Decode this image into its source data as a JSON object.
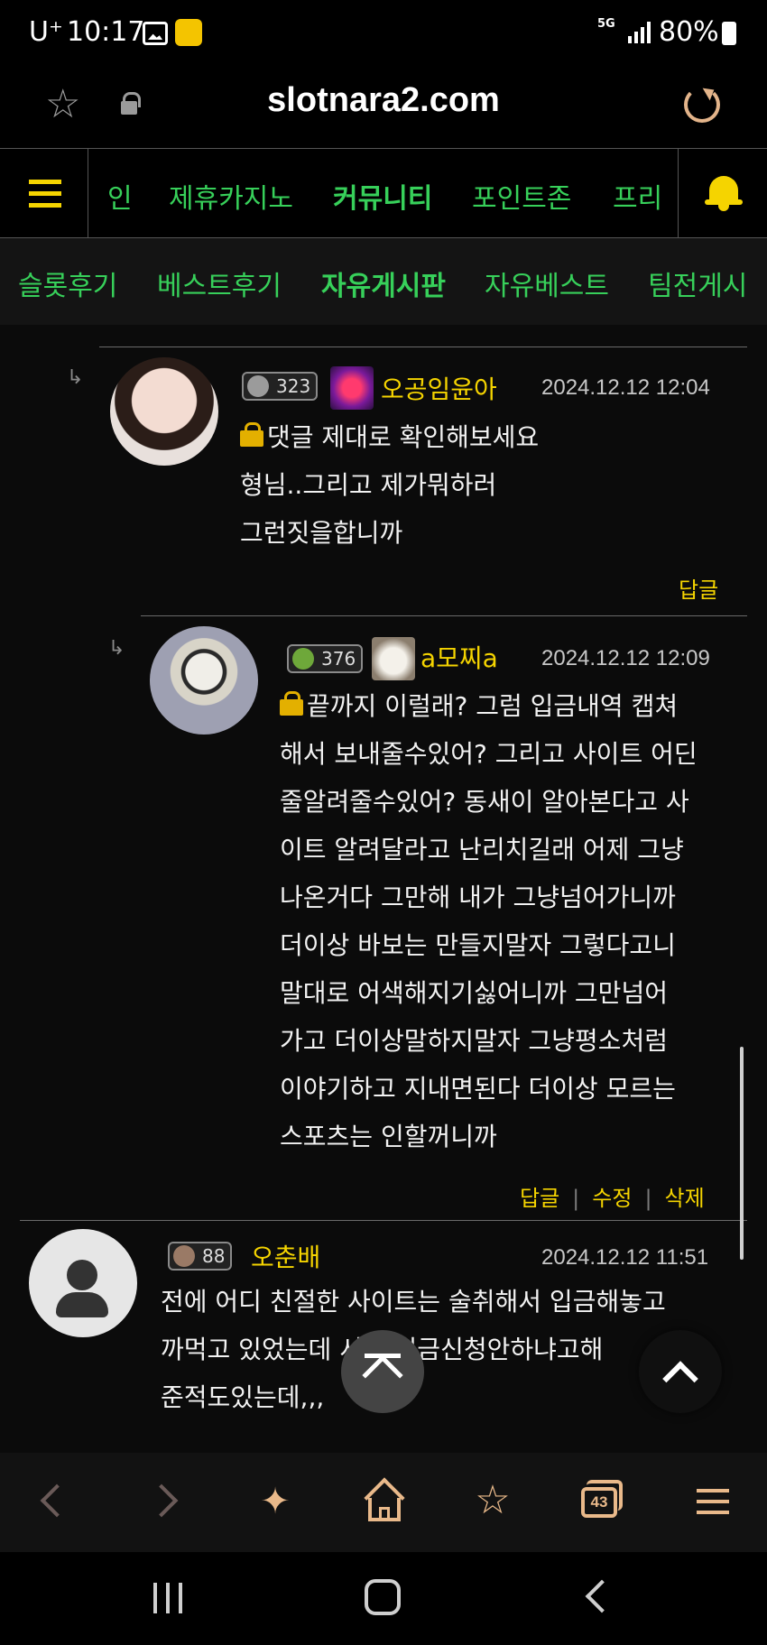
{
  "status_bar": {
    "carrier": "U⁺",
    "time": "10:17",
    "network": "5G",
    "battery": "80%"
  },
  "browser": {
    "url": "slotnara2.com"
  },
  "main_nav": {
    "items": [
      "인",
      "제휴카지노",
      "커뮤니티",
      "포인트존",
      "프리"
    ],
    "active": "커뮤니티"
  },
  "sub_nav": {
    "items": [
      "슬롯후기",
      "베스트후기",
      "자유게시판",
      "자유베스트",
      "팀전게시"
    ],
    "active": "자유게시판"
  },
  "comments": [
    {
      "level": "323",
      "nickname": "오공임윤아",
      "date": "2024.12.12 12:04",
      "lines": [
        "댓글 제대로 확인해보세요",
        "형님..그리고 제가뭐하러",
        "그런짓을합니까"
      ],
      "actions": [
        "답글"
      ]
    },
    {
      "level": "376",
      "nickname": "a모찌a",
      "date": "2024.12.12 12:09",
      "lines": [
        "끝까지 이럴래? 그럼 입금내역 캡쳐",
        "해서 보내줄수있어? 그리고 사이트 어딘",
        "줄알려줄수있어? 동새이 알아본다고 사",
        "이트 알려달라고 난리치길래 어제 그냥",
        "나온거다  그만해 내가 그냥넘어가니까",
        "더이상 바보는 만들지말자  그렇다고니",
        "말대로 어색해지기싫어니까  그만넘어",
        "가고 더이상말하지말자 그냥평소처럼",
        "이야기하고 지내면된다 더이상 모르는",
        "스포츠는 인할꺼니까"
      ],
      "actions": [
        "답글",
        "수정",
        "삭제"
      ]
    },
    {
      "level": "88",
      "nickname": "오춘배",
      "date": "2024.12.12 11:51",
      "lines": [
        "전에 어디 친절한 사이트는 술취해서 입금해놓고",
        "까먹고 있었는데        서 왜입금신청안하냐고해",
        "준적도있는데,,,"
      ],
      "actions": []
    }
  ],
  "toolbar": {
    "tab_count": "43"
  },
  "colors": {
    "accent_green": "#37d05a",
    "accent_yellow": "#f5d400",
    "background": "#0b0b0b"
  }
}
